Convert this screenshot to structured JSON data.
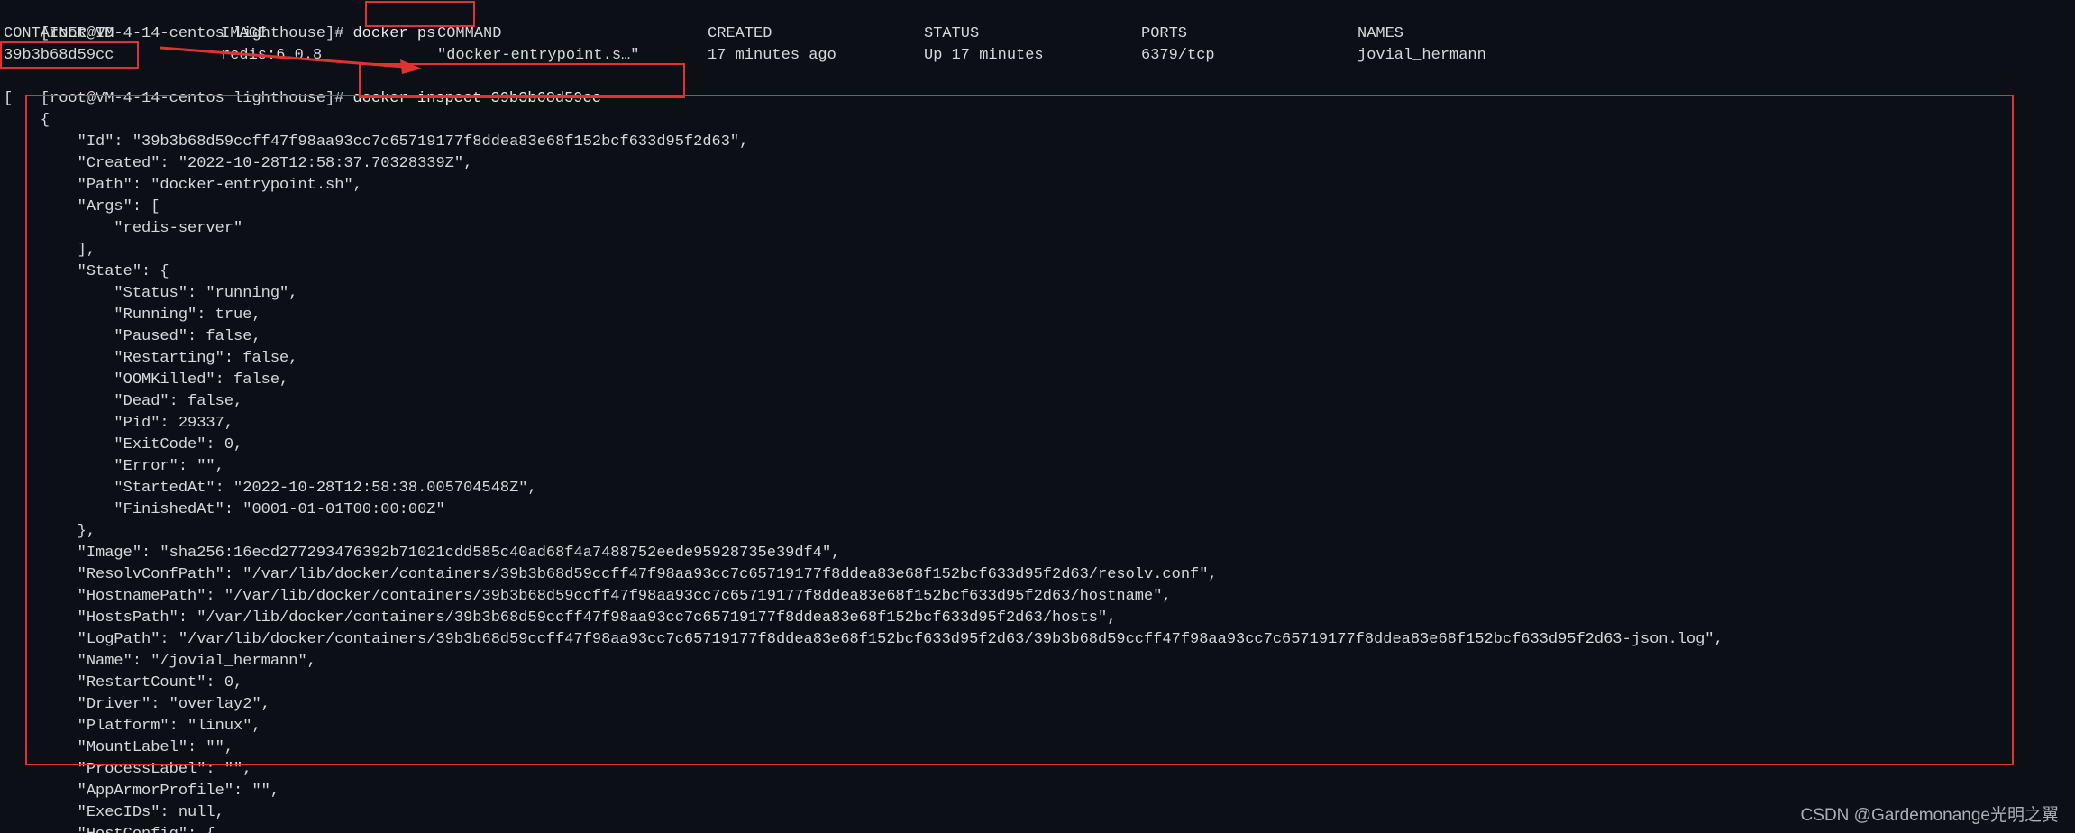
{
  "prompt": "[root@VM-4-14-centos lighthouse]#",
  "commands": {
    "ps": "docker ps",
    "inspect": "docker inspect 39b3b68d59cc"
  },
  "ps_table": {
    "headers": [
      "CONTAINER ID",
      "IMAGE",
      "COMMAND",
      "CREATED",
      "STATUS",
      "PORTS",
      "NAMES"
    ],
    "row": [
      "39b3b68d59cc",
      "redis:6.0.8",
      "\"docker-entrypoint.s…\"",
      "17 minutes ago",
      "Up 17 minutes",
      "6379/tcp",
      "jovial_hermann"
    ]
  },
  "json_lines": [
    "[",
    "    {",
    "        \"Id\": \"39b3b68d59ccff47f98aa93cc7c65719177f8ddea83e68f152bcf633d95f2d63\",",
    "        \"Created\": \"2022-10-28T12:58:37.70328339Z\",",
    "        \"Path\": \"docker-entrypoint.sh\",",
    "        \"Args\": [",
    "            \"redis-server\"",
    "        ],",
    "        \"State\": {",
    "            \"Status\": \"running\",",
    "            \"Running\": true,",
    "            \"Paused\": false,",
    "            \"Restarting\": false,",
    "            \"OOMKilled\": false,",
    "            \"Dead\": false,",
    "            \"Pid\": 29337,",
    "            \"ExitCode\": 0,",
    "            \"Error\": \"\",",
    "            \"StartedAt\": \"2022-10-28T12:58:38.005704548Z\",",
    "            \"FinishedAt\": \"0001-01-01T00:00:00Z\"",
    "        },",
    "        \"Image\": \"sha256:16ecd277293476392b71021cdd585c40ad68f4a7488752eede95928735e39df4\",",
    "        \"ResolvConfPath\": \"/var/lib/docker/containers/39b3b68d59ccff47f98aa93cc7c65719177f8ddea83e68f152bcf633d95f2d63/resolv.conf\",",
    "        \"HostnamePath\": \"/var/lib/docker/containers/39b3b68d59ccff47f98aa93cc7c65719177f8ddea83e68f152bcf633d95f2d63/hostname\",",
    "        \"HostsPath\": \"/var/lib/docker/containers/39b3b68d59ccff47f98aa93cc7c65719177f8ddea83e68f152bcf633d95f2d63/hosts\",",
    "        \"LogPath\": \"/var/lib/docker/containers/39b3b68d59ccff47f98aa93cc7c65719177f8ddea83e68f152bcf633d95f2d63/39b3b68d59ccff47f98aa93cc7c65719177f8ddea83e68f152bcf633d95f2d63-json.log\",",
    "        \"Name\": \"/jovial_hermann\",",
    "        \"RestartCount\": 0,",
    "        \"Driver\": \"overlay2\",",
    "        \"Platform\": \"linux\",",
    "        \"MountLabel\": \"\",",
    "        \"ProcessLabel\": \"\",",
    "        \"AppArmorProfile\": \"\",",
    "        \"ExecIDs\": null,",
    "        \"HostConfig\": {"
  ],
  "watermark": "CSDN @Gardemonange光明之翼",
  "colors": {
    "highlight": "#e0322f",
    "background": "#0c0f16",
    "text": "#d6d8da"
  }
}
